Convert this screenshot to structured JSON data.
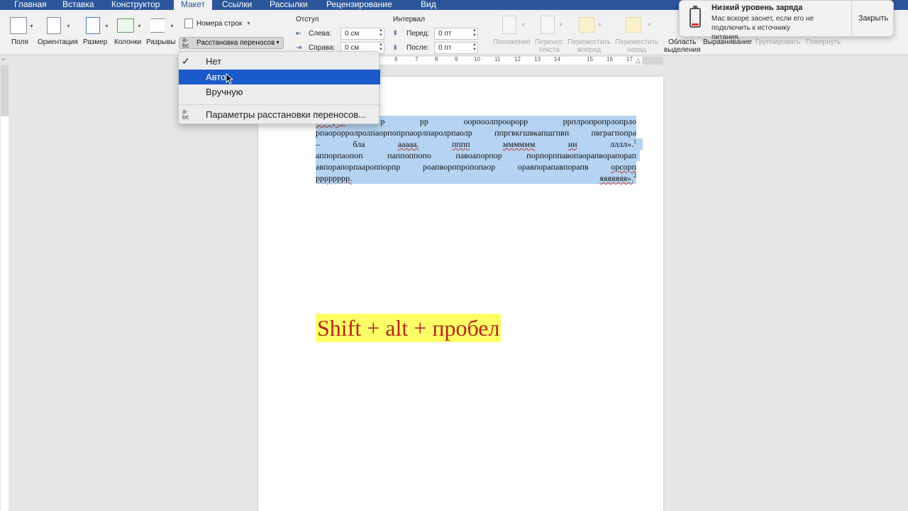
{
  "tabs": [
    "Главная",
    "Вставка",
    "Конструктор",
    "Макет",
    "Ссылки",
    "Рассылки",
    "Рецензирование",
    "Вид"
  ],
  "ribbon": {
    "page_setup": {
      "margins": "Поля",
      "orientation": "Ориентация",
      "size": "Размер",
      "columns": "Колонки",
      "breaks": "Разрывы",
      "line_numbers": "Номера строк",
      "hyphenation": "Расстановка переносов"
    },
    "indent": {
      "header": "Отступ",
      "left_label": "Слева:",
      "left_value": "0 см",
      "right_label": "Справа:",
      "right_value": "0 см"
    },
    "spacing": {
      "header": "Интервал",
      "before_label": "Перед:",
      "before_value": "0 пт",
      "after_label": "После:",
      "after_value": "0 пт"
    },
    "arrange": {
      "position": "Положение",
      "wrap_l1": "Перенос",
      "wrap_l2": "текста",
      "forward_l1": "Переместить",
      "forward_l2": "вперед",
      "backward_l1": "Переместить",
      "backward_l2": "назад",
      "pane_l1": "Область",
      "pane_l2": "выделения",
      "align": "Выравнивание",
      "group": "Группировать",
      "rotate": "Повернуть"
    }
  },
  "ruler_numbers": [
    "6",
    "7",
    "8",
    "9",
    "10",
    "11",
    "12",
    "13",
    "14",
    "15",
    "16",
    "17"
  ],
  "hyphenation_menu": {
    "items": [
      "Нет",
      "Авто",
      "Вручную"
    ],
    "checked": "Нет",
    "highlighted": "Авто",
    "options_label": "Параметры расстановки переносов..."
  },
  "document": {
    "line1": [
      "…олрор",
      "р",
      "рр",
      "оорпоолпроорорр",
      "ррплропропрлопрло"
    ],
    "line2": [
      "рпаорорролролпаорпопрпаорлпаролрпаолр",
      "ппргвкгшвкапшгпвп",
      "пвграгпопра"
    ],
    "line3": [
      "–",
      "бла",
      "ааааа.",
      "пппп",
      "мммммм",
      "ии",
      "лллл»."
    ],
    "line3_sup": "1",
    "line4": [
      "аппорпаопоп",
      "паппоппопо",
      "павоапорпор",
      "порпорппавопаорапворапорап"
    ],
    "line5": [
      "авпорапорпаароппорпр",
      "роапворппропопаор",
      "оравпорапавпорапв",
      "орсорп"
    ],
    "line6": [
      "рррррррр.",
      "яяяяяяя»."
    ],
    "line6_sup": "2",
    "big_text": "Shift + alt + пробел"
  },
  "notification": {
    "title": "Низкий уровень заряда",
    "body": "Мас вскоре заснет, если его не подключить к источнику питания.",
    "close_label": "Закрыть"
  },
  "colors": {
    "tab_bar": "#2b579a",
    "menu_highlight": "#1b5ac9",
    "selection": "#b5d3f2",
    "text_highlight": "#ffff66",
    "big_text_color": "#b5261e"
  }
}
